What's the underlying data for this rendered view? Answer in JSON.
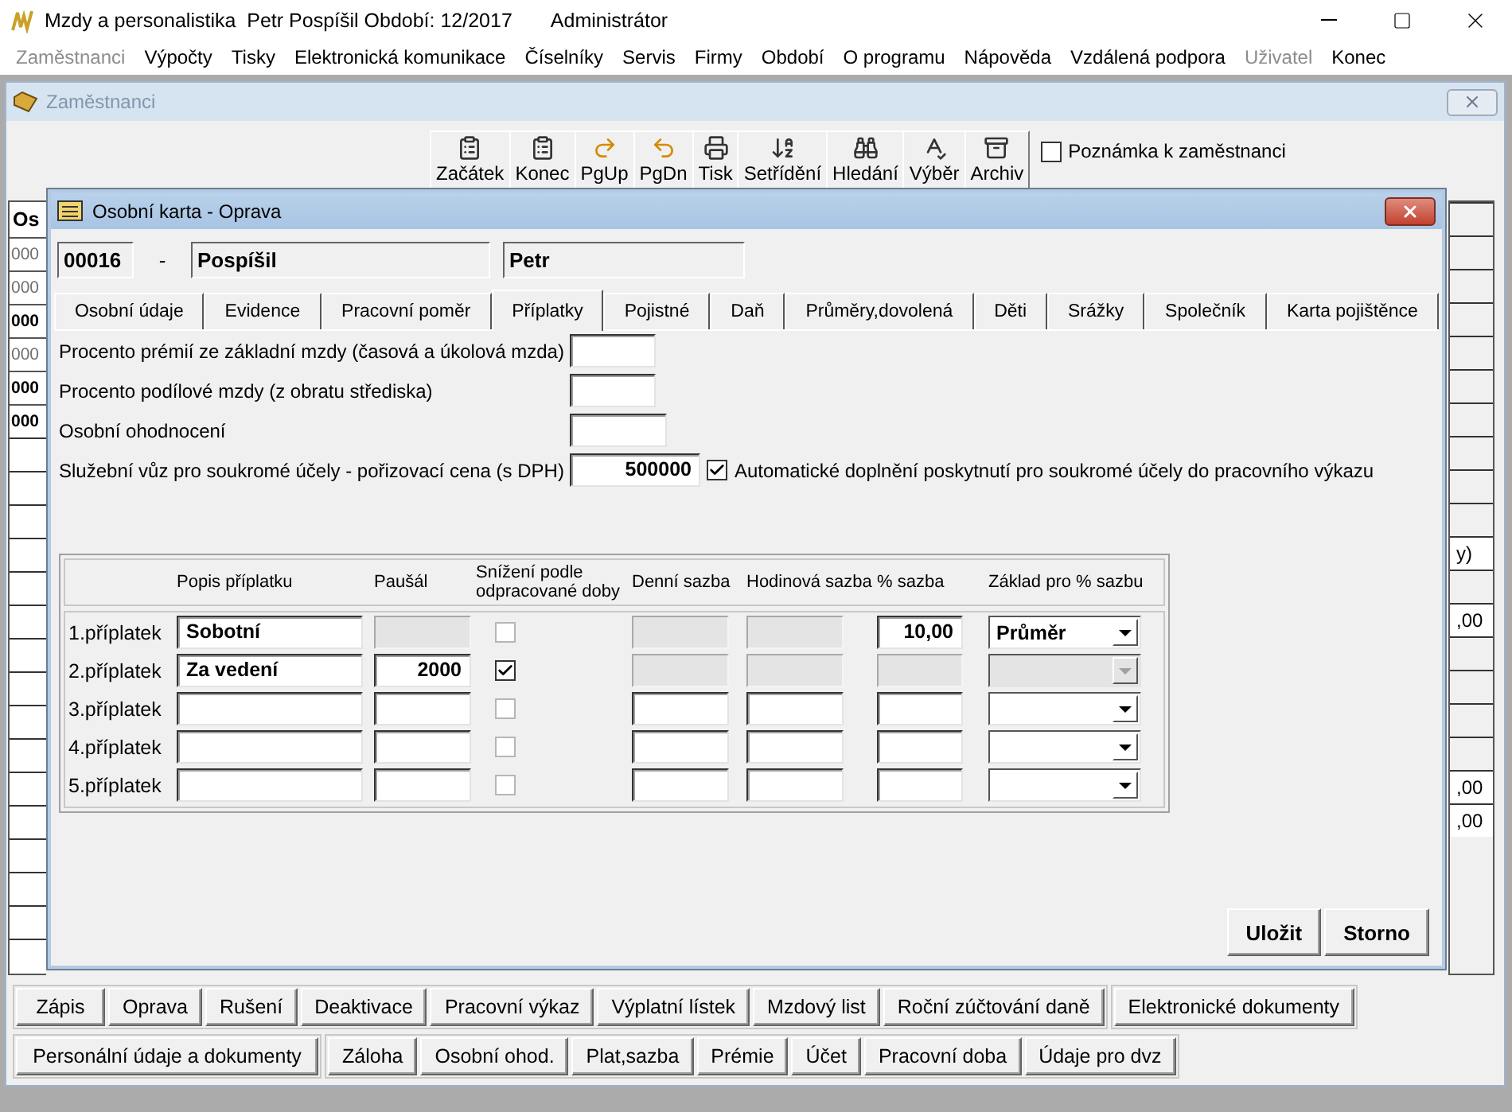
{
  "app_window": {
    "title": "Mzdy a personalistika  Petr Pospíšil Období: 12/2017",
    "user": "Administrátor"
  },
  "menu": [
    {
      "label": "Zaměstnanci",
      "disabled": true
    },
    {
      "label": "Výpočty",
      "disabled": false
    },
    {
      "label": "Tisky",
      "disabled": false
    },
    {
      "label": "Elektronická komunikace",
      "disabled": false
    },
    {
      "label": "Číselníky",
      "disabled": false
    },
    {
      "label": "Servis",
      "disabled": false
    },
    {
      "label": "Firmy",
      "disabled": false
    },
    {
      "label": "Období",
      "disabled": false
    },
    {
      "label": "O programu",
      "disabled": false
    },
    {
      "label": "Nápověda",
      "disabled": false
    },
    {
      "label": "Vzdálená podpora",
      "disabled": false
    },
    {
      "label": "Uživatel",
      "disabled": true
    },
    {
      "label": "Konec",
      "disabled": false
    }
  ],
  "employees_window": {
    "title": "Zaměstnanci",
    "toolbar": [
      "Začátek",
      "Konec",
      "PgUp",
      "PgDn",
      "Tisk",
      "Setřídění",
      "Hledání",
      "Výběr",
      "Archiv"
    ],
    "note_checkbox": {
      "label": "Poznámka k zaměstnanci",
      "checked": false
    },
    "list_header": "Os",
    "list_cells": [
      {
        "text": "000",
        "inactive": true
      },
      {
        "text": "000",
        "inactive": true
      },
      {
        "text": "000",
        "inactive": false
      },
      {
        "text": "000",
        "inactive": true
      },
      {
        "text": "000",
        "inactive": false
      },
      {
        "text": "000",
        "inactive": false
      }
    ],
    "right_header": "y)",
    "right_cells": [
      ",00",
      ",00",
      ",00"
    ],
    "buttons_row1": [
      "Zápis",
      "Oprava",
      "Rušení",
      "Deaktivace",
      "Pracovní výkaz",
      "Výplatní lístek",
      "Mzdový list",
      "Roční zúčtování daně"
    ],
    "extra_button": "Elektronické dokumenty",
    "buttons_row2_first": "Personální údaje a dokumenty",
    "buttons_row2": [
      "Záloha",
      "Osobní ohod.",
      "Plat,sazba",
      "Prémie",
      "Účet",
      "Pracovní doba",
      "Údaje pro dvz"
    ]
  },
  "dialog": {
    "title": "Osobní karta - Oprava",
    "employee_id": "00016",
    "separator": "-",
    "surname": "Pospíšil",
    "first_name": "Petr",
    "tabs": [
      {
        "label": "Osobní údaje",
        "selected": false
      },
      {
        "label": "Evidence",
        "selected": false
      },
      {
        "label": "Pracovní poměr",
        "selected": false
      },
      {
        "label": "Příplatky",
        "selected": true
      },
      {
        "label": "Pojistné",
        "selected": false
      },
      {
        "label": "Daň",
        "selected": false
      },
      {
        "label": "Průměry,dovolená",
        "selected": false
      },
      {
        "label": "Děti",
        "selected": false
      },
      {
        "label": "Srážky",
        "selected": false
      },
      {
        "label": "Společník",
        "selected": false
      },
      {
        "label": "Karta pojištěnce",
        "selected": false
      }
    ],
    "fields": [
      {
        "label": "Procento prémií ze základní mzdy (časová a úkolová mzda)"
      },
      {
        "label": "Procento podílové mzdy (z obratu střediska)"
      },
      {
        "label": "Osobní ohodnocení"
      },
      {
        "label": "Služební vůz pro soukromé účely - pořizovací cena (s DPH)",
        "value": "500000"
      }
    ],
    "auto_fill": {
      "label": "Automatické doplnění poskytnutí pro soukromé účely do pracovního výkazu",
      "checked": true
    },
    "columns": [
      "Popis příplatku",
      "Paušál",
      "Snížení podle odpracované doby",
      "Denní sazba",
      "Hodinová sazba",
      "% sazba",
      "Základ pro % sazbu"
    ],
    "rows": [
      {
        "label": "1.příplatek",
        "description": "Sobotní",
        "lump": {
          "disabled": true
        },
        "reduce": {
          "checked": false,
          "disabled": true
        },
        "daily": {
          "disabled": true
        },
        "hourly": {
          "disabled": true
        },
        "percent": {
          "value": "10,00",
          "disabled": false
        },
        "base": {
          "value": "Průměr",
          "disabled": false
        }
      },
      {
        "label": "2.příplatek",
        "description": "Za vedení",
        "lump": {
          "value": "2000",
          "disabled": false
        },
        "reduce": {
          "checked": true,
          "disabled": false
        },
        "daily": {
          "disabled": true
        },
        "hourly": {
          "disabled": true
        },
        "percent": {
          "disabled": true
        },
        "base": {
          "disabled": true
        }
      },
      {
        "label": "3.příplatek",
        "lump": {
          "disabled": false
        },
        "reduce": {
          "checked": false,
          "disabled": true
        },
        "daily": {
          "disabled": false
        },
        "hourly": {
          "disabled": false
        },
        "percent": {
          "disabled": false
        },
        "base": {
          "disabled": false
        }
      },
      {
        "label": "4.příplatek",
        "lump": {
          "disabled": false
        },
        "reduce": {
          "checked": false,
          "disabled": true
        },
        "daily": {
          "disabled": false
        },
        "hourly": {
          "disabled": false
        },
        "percent": {
          "disabled": false
        },
        "base": {
          "disabled": false
        }
      },
      {
        "label": "5.příplatek",
        "lump": {
          "disabled": false
        },
        "reduce": {
          "checked": false,
          "disabled": true
        },
        "daily": {
          "disabled": false
        },
        "hourly": {
          "disabled": false
        },
        "percent": {
          "disabled": false
        },
        "base": {
          "disabled": false
        }
      }
    ],
    "buttons": [
      "Uložit",
      "Storno"
    ]
  }
}
